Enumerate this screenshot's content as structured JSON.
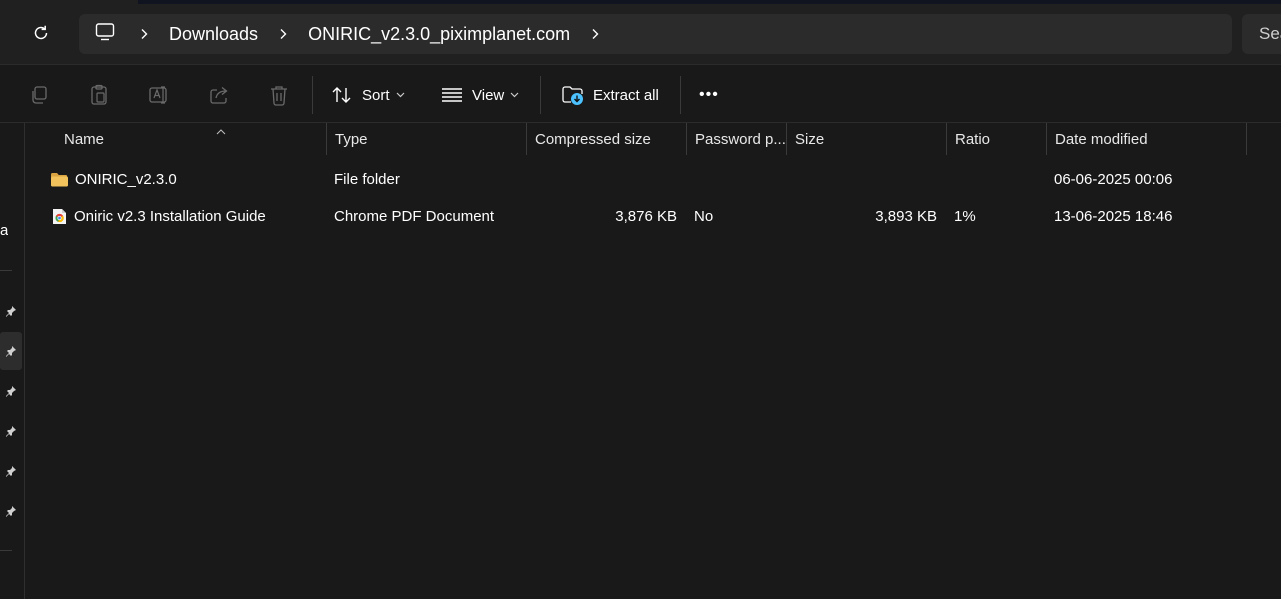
{
  "breadcrumb": {
    "items": [
      "Downloads",
      "ONIRIC_v2.3.0_piximplanet.com"
    ]
  },
  "search": {
    "placeholder": "Sea"
  },
  "toolbar": {
    "copy": "copy-icon",
    "paste": "paste-icon",
    "rename": "rename-icon",
    "share": "share-icon",
    "delete": "delete-icon",
    "sort_label": "Sort",
    "view_label": "View",
    "extract_label": "Extract all",
    "more_label": "•••"
  },
  "nav": {
    "fragment": "al"
  },
  "columns": {
    "name": "Name",
    "type": "Type",
    "compressed": "Compressed size",
    "password": "Password p...",
    "size": "Size",
    "ratio": "Ratio",
    "date": "Date modified"
  },
  "files": [
    {
      "name": "ONIRIC_v2.3.0",
      "type": "File folder",
      "compressed": "",
      "password": "",
      "size": "",
      "ratio": "",
      "date": "06-06-2025 00:06",
      "icon": "folder-icon"
    },
    {
      "name": "Oniric v2.3 Installation Guide",
      "type": "Chrome PDF Document",
      "compressed": "3,876 KB",
      "password": "No",
      "size": "3,893 KB",
      "ratio": "1%",
      "date": "13-06-2025 18:46",
      "icon": "chrome-pdf-icon"
    }
  ],
  "colors": {
    "background": "#191919",
    "bar": "#202020",
    "crumb_bg": "#2b2b2b",
    "folder": "#f2c35c",
    "accent": "#4cc2ff"
  }
}
